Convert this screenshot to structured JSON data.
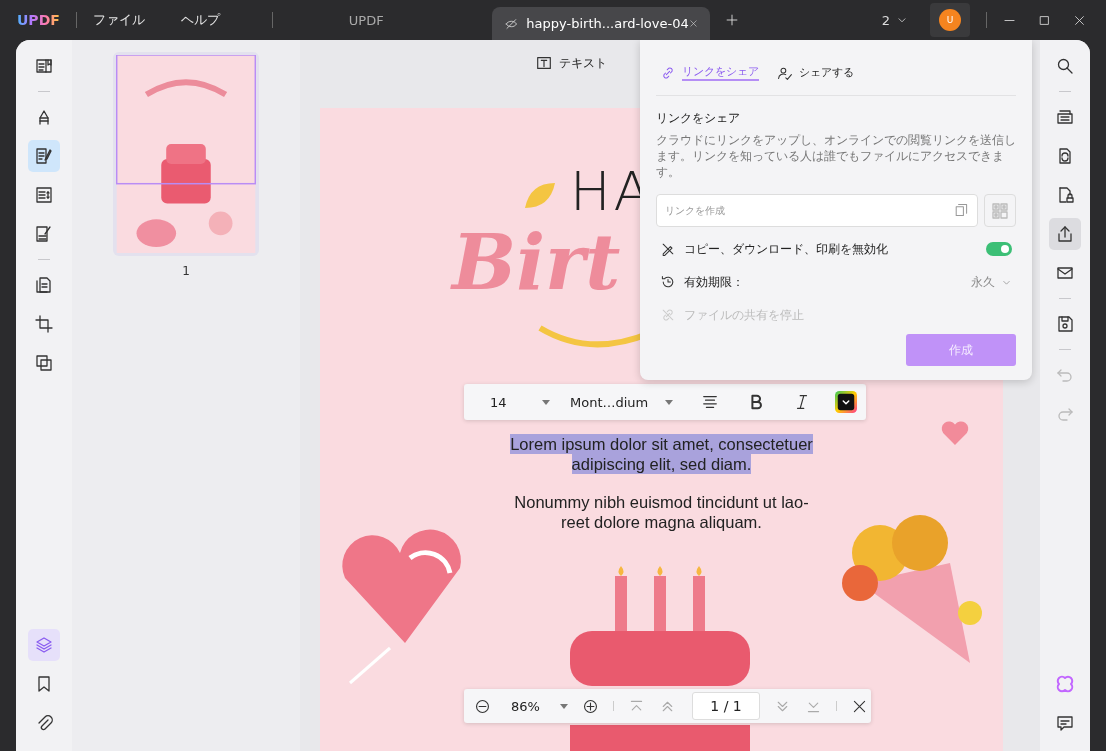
{
  "titlebar": {
    "logo": "UPDF",
    "menus": [
      "ファイル",
      "ヘルプ"
    ],
    "app_title": "UPDF",
    "page_count": "2",
    "avatar": "U"
  },
  "tabs": [
    {
      "label": "happy-birth...ard-love-04",
      "selected": true
    }
  ],
  "left_tools": {
    "groups": [
      [
        {
          "kind": "reader",
          "selected": false
        }
      ],
      [
        {
          "kind": "highlight",
          "selected": false
        },
        {
          "kind": "edit",
          "selected": true
        },
        {
          "kind": "form",
          "selected": false
        },
        {
          "kind": "sign",
          "selected": false
        }
      ],
      [
        {
          "kind": "pages",
          "selected": false
        },
        {
          "kind": "crop",
          "selected": false
        },
        {
          "kind": "copy",
          "selected": false
        }
      ]
    ],
    "bottom": [
      {
        "kind": "layers",
        "selected": true
      },
      {
        "kind": "bookmark",
        "selected": false
      },
      {
        "kind": "attachment",
        "selected": false
      }
    ]
  },
  "thumbnail": {
    "page_label": "1"
  },
  "edit_mode": {
    "label": "テキスト"
  },
  "page": {
    "heading": [
      "HA",
      "Birt"
    ],
    "paragraphs": [
      {
        "lines": [
          "Lorem ipsum dolor sit amet, consectetuer",
          "adipiscing elit, sed diam."
        ],
        "selected": true
      },
      {
        "lines": [
          "Nonummy nibh euismod tincidunt ut lao-",
          "reet dolore magna aliquam."
        ],
        "selected": false
      }
    ]
  },
  "text_toolbar": {
    "font_size": "14",
    "font": "Mont…dium"
  },
  "share_panel": {
    "tabs": [
      {
        "label": "リンクをシェア",
        "kind": "link",
        "selected": true
      },
      {
        "label": "シェアする",
        "kind": "share",
        "selected": false
      }
    ],
    "heading": "リンクをシェア",
    "description": "クラウドにリンクをアップし、オンラインでの閲覧リンクを送信します。リンクを知っている人は誰でもファイルにアクセスできます。",
    "link_field": {
      "placeholder": "リンクを作成"
    },
    "options": [
      {
        "kind": "toggle",
        "label": "コピー、ダウンロード、印刷を無効化",
        "on": true,
        "disabled": false
      },
      {
        "kind": "select",
        "label": "有効期限：",
        "value": "永久",
        "disabled": false
      },
      {
        "kind": "action",
        "label": "ファイルの共有を停止",
        "disabled": true
      }
    ],
    "create_button": {
      "label": "作成",
      "disabled": true
    }
  },
  "zoom_bar": {
    "zoom": "86%",
    "page": "1 / 1"
  },
  "right_tools": {
    "groups": [
      [
        {
          "kind": "search",
          "selected": false,
          "disabled": false
        }
      ],
      [
        {
          "kind": "ocr",
          "selected": false,
          "disabled": false
        },
        {
          "kind": "convert",
          "selected": false,
          "disabled": false
        },
        {
          "kind": "protect",
          "selected": false,
          "disabled": false
        },
        {
          "kind": "share",
          "selected": true,
          "disabled": false
        },
        {
          "kind": "mail",
          "selected": false,
          "disabled": false
        }
      ],
      [
        {
          "kind": "save",
          "selected": false,
          "disabled": false
        }
      ],
      [
        {
          "kind": "undo",
          "selected": false,
          "disabled": true
        },
        {
          "kind": "redo",
          "selected": false,
          "disabled": true
        }
      ]
    ],
    "bottom": [
      {
        "kind": "ai",
        "selected": false
      },
      {
        "kind": "comment",
        "selected": false
      }
    ]
  }
}
